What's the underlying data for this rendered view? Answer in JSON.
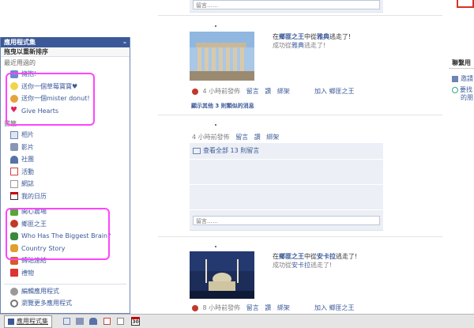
{
  "colors": {
    "brand": "#3b5998",
    "highlight": "#ff44ff",
    "link": "#3b5998"
  },
  "feed": {
    "top_comment_placeholder": "留言……",
    "story1": {
      "line1_prefix": "在",
      "line1_app": "鄉匪之王",
      "line1_mid": "中從",
      "line1_place": "雅典",
      "line1_suffix": "逃走了!",
      "line2_prefix": "成功從",
      "line2_place": "雅典",
      "line2_suffix": "逃走了!",
      "time": "4 小時前發佈",
      "actions": [
        "留言",
        "讚",
        "綁架"
      ],
      "join": "加入 鄉匪之王",
      "show_others": "顯示其他 3 則類似的消息"
    },
    "story2": {
      "time": "4 小時前發佈",
      "actions": [
        "留言",
        "讚",
        "綁架"
      ],
      "view_all": "查看全部 13 則留言",
      "comment_placeholder": "留言……"
    },
    "story3": {
      "line1_prefix": "在",
      "line1_app": "鄉匪之王",
      "line1_mid": "中從",
      "line1_place": "安卡拉",
      "line1_suffix": "逃走了!",
      "line2_prefix": "成功從",
      "line2_place": "安卡拉",
      "line2_suffix": "逃走了!",
      "time": "8 小時前發佈",
      "actions": [
        "留言",
        "讚",
        "綁架"
      ],
      "join": "加入 鄉匪之王"
    }
  },
  "right_col": {
    "title": "聯繫用",
    "item1": "邀請",
    "item2": "要找",
    "item3": "的朋"
  },
  "apps_panel": {
    "title": "應用程式集",
    "minimize": "–",
    "drag_hint": "拖曳以重新排序",
    "recent_label": "最近用過的",
    "recent": [
      "擁抱!",
      "送你一個草莓寶寶♥",
      "送你一個mister donut!",
      "Give Hearts"
    ],
    "bookmarks_label": "書籤",
    "bookmarks": [
      "相片",
      "影片",
      "社團",
      "活動",
      "網誌",
      "我的日历"
    ],
    "apps": [
      "開心農場",
      "鄉匪之王",
      "Who Has The Biggest Brain?",
      "Country Story"
    ],
    "more": [
      "轉貼連結",
      "禮物"
    ],
    "footer": [
      "編輯應用程式",
      "瀏覽更多應用程式"
    ]
  },
  "bottom_bar": {
    "apps_tab": "應用程式集",
    "calendar_day": "30"
  }
}
